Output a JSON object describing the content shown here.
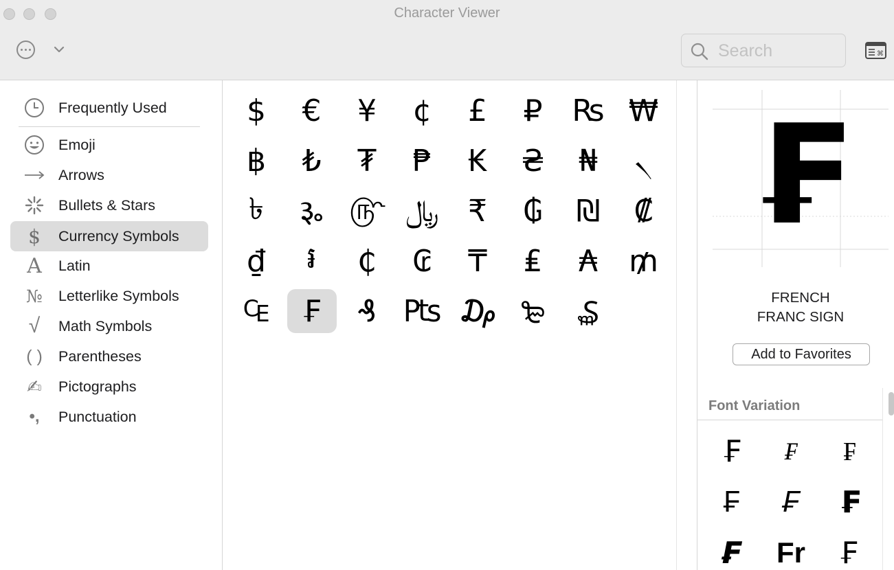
{
  "window": {
    "title": "Character Viewer"
  },
  "toolbar": {
    "more_icon": "ellipsis-circle-icon",
    "chevron_icon": "chevron-down-icon",
    "search_placeholder": "Search",
    "search_value": "",
    "keyboard_icon": "keyboard-viewer-icon"
  },
  "sidebar": {
    "items": [
      {
        "label": "Frequently Used",
        "icon": "◷",
        "icon_name": "clock-icon",
        "selected": false
      },
      {
        "label": "Emoji",
        "icon": "☺",
        "icon_name": "smiley-icon",
        "selected": false
      },
      {
        "label": "Arrows",
        "icon": "→",
        "icon_name": "arrow-icon",
        "selected": false
      },
      {
        "label": "Bullets & Stars",
        "icon": "✳",
        "icon_name": "asterisk-icon",
        "selected": false
      },
      {
        "label": "Currency Symbols",
        "icon": "$",
        "icon_name": "dollar-icon",
        "selected": true
      },
      {
        "label": "Latin",
        "icon": "A",
        "icon_name": "latin-a-icon",
        "selected": false
      },
      {
        "label": "Letterlike Symbols",
        "icon": "№",
        "icon_name": "numero-icon",
        "selected": false
      },
      {
        "label": "Math Symbols",
        "icon": "√",
        "icon_name": "square-root-icon",
        "selected": false
      },
      {
        "label": "Parentheses",
        "icon": "( )",
        "icon_name": "parentheses-icon",
        "selected": false
      },
      {
        "label": "Pictographs",
        "icon": "✍",
        "icon_name": "writing-hand-icon",
        "selected": false
      },
      {
        "label": "Punctuation",
        "icon": "•,",
        "icon_name": "punctuation-icon",
        "selected": false
      }
    ]
  },
  "grid": {
    "rows": [
      [
        "$",
        "€",
        "¥",
        "¢",
        "£",
        "₽",
        "₨",
        "₩"
      ],
      [
        "฿",
        "₺",
        "₮",
        "₱",
        "₭",
        "₴",
        "₦",
        "৲"
      ],
      [
        "৳",
        "૱",
        "௹",
        "﷼",
        "₹",
        "₲",
        "₪",
        "₡"
      ],
      [
        "₫",
        "៛",
        "₵",
        "₢",
        "₸",
        "₤",
        "₳",
        "₥"
      ],
      [
        "₠",
        "₣",
        "₰",
        "₧",
        "₯",
        "₻",
        "₷"
      ]
    ],
    "selected_row": 4,
    "selected_col": 1
  },
  "detail": {
    "preview_char": "₣",
    "name": "FRENCH\nFRANC SIGN",
    "add_favorites_label": "Add to Favorites",
    "font_variation_title": "Font Variation",
    "font_variations": [
      "₣",
      "₣",
      "₣",
      "₣",
      "₣",
      "₣",
      "₣",
      "Fr",
      "₣"
    ]
  }
}
